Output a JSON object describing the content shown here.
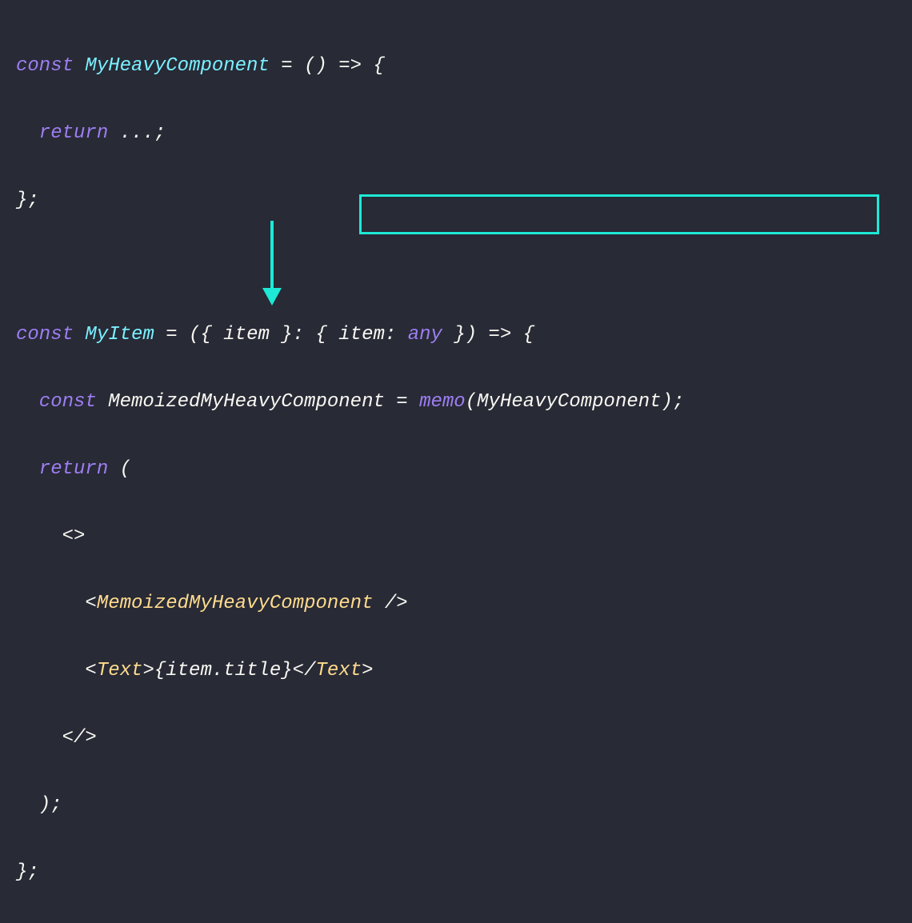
{
  "line1": {
    "t1": "const ",
    "t2": "MyHeavyComponent ",
    "t3": "= () => {"
  },
  "line2": {
    "t1": "  return ",
    "t2": "...;"
  },
  "line3": {
    "t1": "};"
  },
  "line5": {
    "t1": "const ",
    "t2": "MyItem ",
    "t3": "= ({ ",
    "t4": "item ",
    "t5": "}: { ",
    "t6": "item",
    "t7": ": ",
    "t8": "any ",
    "t9": "}) => {"
  },
  "line6": {
    "t1": "  const ",
    "t2": "MemoizedMyHeavyComponent ",
    "t3": "= ",
    "t4": "memo",
    "t5": "(",
    "t6": "MyHeavyComponent",
    "t7": ");"
  },
  "line7": {
    "t1": "  return ",
    "t2": "("
  },
  "line8": {
    "t1": "    <>"
  },
  "line9": {
    "t1": "      <",
    "t2": "MemoizedMyHeavyComponent ",
    "t3": "/>"
  },
  "line10": {
    "t1": "      <",
    "t2": "Text",
    "t3": ">{",
    "t4": "item",
    "t5": ".",
    "t6": "title",
    "t7": "}</",
    "t8": "Text",
    "t9": ">"
  },
  "line11": {
    "t1": "    </>"
  },
  "line12": {
    "t1": "  );"
  },
  "line13": {
    "t1": "};"
  }
}
